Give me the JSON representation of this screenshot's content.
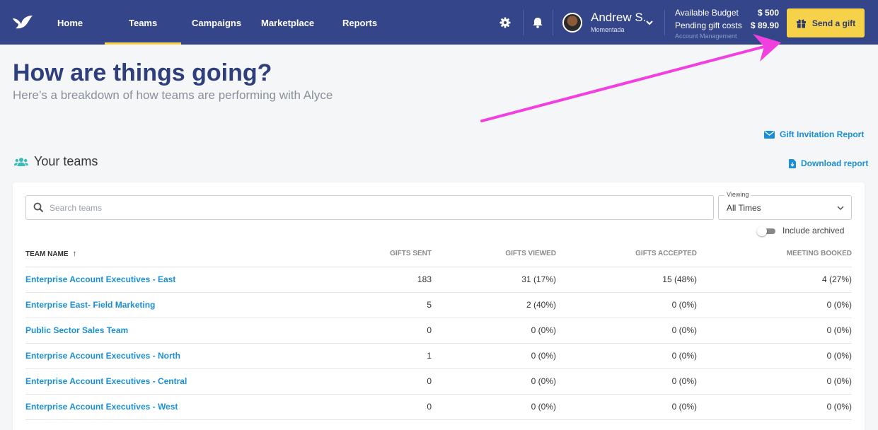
{
  "nav": {
    "items": [
      {
        "label": "Home",
        "active": false
      },
      {
        "label": "Teams",
        "active": true
      },
      {
        "label": "Campaigns",
        "active": false
      },
      {
        "label": "Marketplace",
        "active": false
      },
      {
        "label": "Reports",
        "active": false
      }
    ],
    "user": {
      "name": "Andrew S.",
      "org": "Momentada"
    },
    "budget": {
      "available_label": "Available Budget",
      "available_value": "$ 500",
      "pending_label": "Pending gift costs",
      "pending_value": "$ 89.90",
      "account_link": "Account Management"
    },
    "send_gift_label": "Send a gift",
    "icons": [
      "alyce-logo-icon",
      "gear-icon",
      "bell-icon",
      "chevron-down-icon",
      "gift-icon"
    ]
  },
  "page": {
    "title": "How are things going?",
    "subtitle": "Here’s a breakdown of how teams are performing with Alyce"
  },
  "links": {
    "gift_invitation_report": "Gift Invitation Report",
    "download_report": "Download report"
  },
  "teams_section": {
    "heading": "Your teams",
    "search_placeholder": "Search teams",
    "viewing_label": "Viewing",
    "viewing_value": "All Times",
    "include_archived_label": "Include archived",
    "include_archived_on": false
  },
  "table": {
    "columns": [
      "TEAM NAME",
      "GIFTS SENT",
      "GIFTS VIEWED",
      "GIFTS ACCEPTED",
      "MEETING BOOKED"
    ],
    "sort_indicator": "↑",
    "rows": [
      [
        "Enterprise Account Executives - East",
        "183",
        "31 (17%)",
        "15 (48%)",
        "4 (27%)"
      ],
      [
        "Enterprise East- Field Marketing",
        "5",
        "2 (40%)",
        "0 (0%)",
        "0 (0%)"
      ],
      [
        "Public Sector Sales Team",
        "0",
        "0 (0%)",
        "0 (0%)",
        "0 (0%)"
      ],
      [
        "Enterprise Account Executives - North",
        "1",
        "0 (0%)",
        "0 (0%)",
        "0 (0%)"
      ],
      [
        "Enterprise Account Executives - Central",
        "0",
        "0 (0%)",
        "0 (0%)",
        "0 (0%)"
      ],
      [
        "Enterprise Account Executives - West",
        "0",
        "0 (0%)",
        "0 (0%)",
        "0 (0%)"
      ]
    ]
  },
  "colors": {
    "nav_bg": "#34458a",
    "accent_yellow": "#f6d24a",
    "link_blue": "#1a8fd6",
    "title_navy": "#2e3f7c",
    "annotation_arrow": "#f23fe0"
  }
}
